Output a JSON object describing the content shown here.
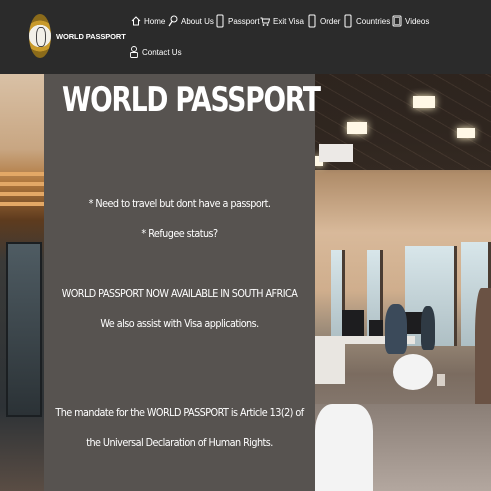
{
  "brand": {
    "name": "WORLD PASSPORT"
  },
  "nav": {
    "items": [
      {
        "label": "Home",
        "icon": "home-icon"
      },
      {
        "label": "About Us",
        "icon": "search-icon"
      },
      {
        "label": "Passport",
        "icon": "phone-icon"
      },
      {
        "label": "Exit Visa",
        "icon": "cart-icon"
      },
      {
        "label": "Order",
        "icon": "phone-icon"
      },
      {
        "label": "Countries",
        "icon": "phone-icon"
      },
      {
        "label": "Videos",
        "icon": "tablet-icon"
      },
      {
        "label": "Contact Us",
        "icon": "contact-icon"
      }
    ]
  },
  "hero": {
    "title": "WORLD PASSPORT",
    "lines": [
      "* Need to travel but dont have a passport.",
      "* Refugee status?",
      "WORLD PASSPORT NOW AVAILABLE IN SOUTH AFRICA",
      "We also assist with Visa applications.",
      "The mandate for the WORLD PASSPORT is Article 13(2) of",
      "the Universal Declaration of Human Rights."
    ]
  },
  "colors": {
    "header_bg": "#2b2b2b",
    "panel_bg": "#575350",
    "text": "#ffffff"
  }
}
